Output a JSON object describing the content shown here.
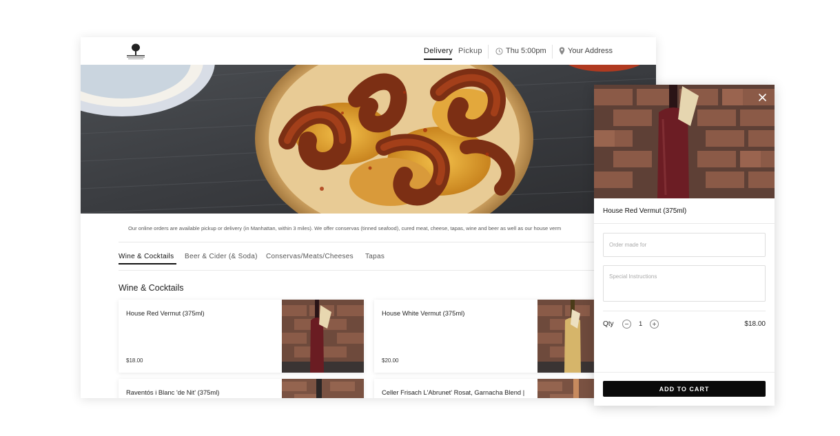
{
  "header": {
    "tabs": [
      {
        "label": "Delivery",
        "active": true
      },
      {
        "label": "Pickup",
        "active": false
      }
    ],
    "time_label": "Thu 5:00pm",
    "address_label": "Your Address",
    "icons": {
      "logo": "tree-logo",
      "time": "clock-icon",
      "address": "location-pin-icon"
    }
  },
  "intro_text": "Our online orders are available pickup or delivery (in Manhattan, within 3 miles). We offer conservas (tinned seafood), cured meat, cheese, tapas, wine and beer as well as our house verm",
  "categories": [
    {
      "label": "Wine & Cocktails",
      "active": true
    },
    {
      "label": "Beer & Cider (& Soda)",
      "active": false
    },
    {
      "label": "Conservas/Meats/Cheeses",
      "active": false
    },
    {
      "label": "Tapas",
      "active": false
    }
  ],
  "section": {
    "title": "Wine & Cocktails",
    "items": [
      {
        "name": "House Red Vermut (375ml)",
        "price": "$18.00"
      },
      {
        "name": "House White Vermut (375ml)",
        "price": "$20.00"
      },
      {
        "name": "Raventós i Blanc 'de Nit' (375ml)",
        "price": ""
      },
      {
        "name": "Celler Frisach L'Abrunet' Rosat, Garnacha Blend |",
        "price": ""
      }
    ]
  },
  "modal": {
    "title": "House Red Vermut (375ml)",
    "order_for_placeholder": "Order made for",
    "instructions_placeholder": "Special Instructions",
    "qty_label": "Qty",
    "qty_value": "1",
    "total": "$18.00",
    "add_button": "ADD TO CART",
    "close_icon": "close-icon"
  },
  "colors": {
    "button_bg": "#0a0a0a",
    "accent": "#111111",
    "muted_text": "#555555"
  }
}
